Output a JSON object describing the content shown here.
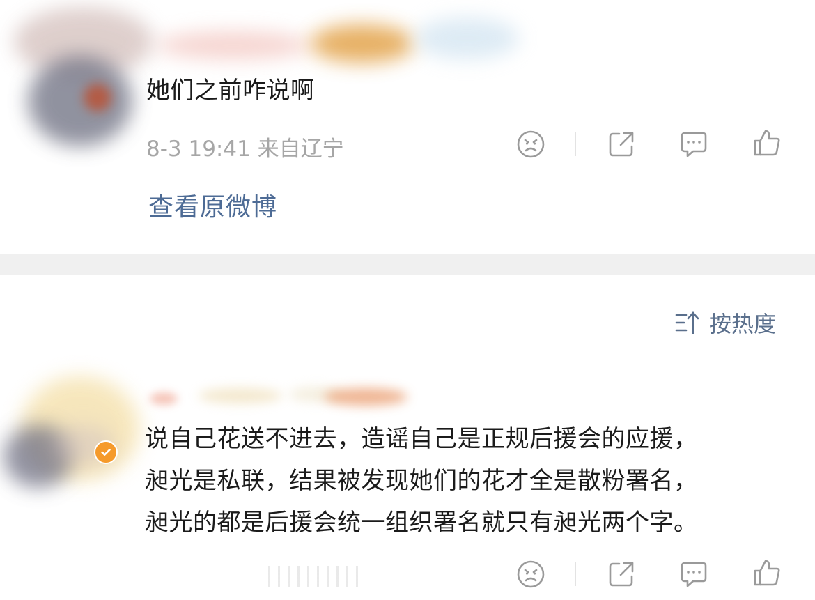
{
  "comments": [
    {
      "text": "她们之前咋说啊",
      "meta": "8-3 19:41 来自辽宁"
    },
    {
      "lines": [
        "说自己花送不进去，造谣自己是正规后援会的应援，",
        "昶光是私联，结果被发现她们的花才全是散粉署名，",
        "昶光的都是后援会统一组织署名就只有昶光两个字。"
      ]
    }
  ],
  "view_original_label": "查看原微博",
  "sort": {
    "label": "按热度",
    "icon": "sort-icon"
  },
  "actions": [
    "dislike-icon",
    "share-icon",
    "comment-icon",
    "like-icon"
  ],
  "colors": {
    "text": "#1b1b1b",
    "meta": "#a6a6a6",
    "link": "#4d6b95",
    "divider": "#f0f0f0",
    "verified_badge": "#f59a2b"
  }
}
